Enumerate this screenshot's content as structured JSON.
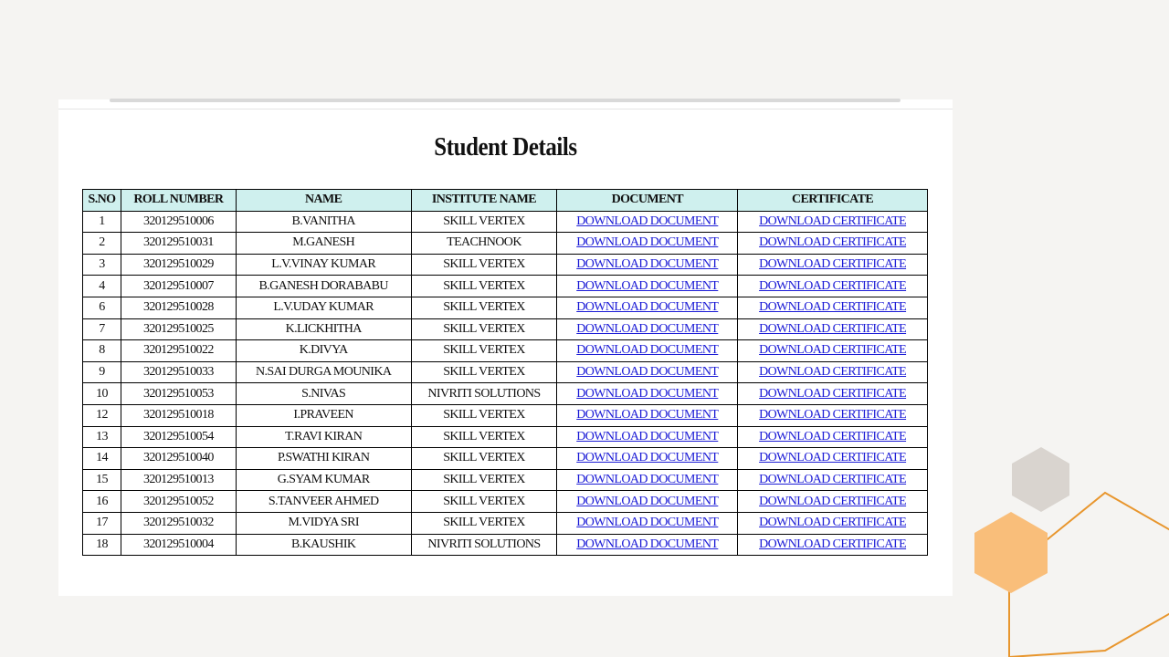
{
  "page": {
    "title": "Student Details"
  },
  "table": {
    "headers": [
      "S.NO",
      "ROLL NUMBER",
      "NAME",
      "INSTITUTE NAME",
      "DOCUMENT",
      "CERTIFICATE"
    ],
    "rows": [
      {
        "sno": "1",
        "roll": "320129510006",
        "name": "B.VANITHA",
        "institute": "SKILL VERTEX",
        "document": "DOWNLOAD DOCUMENT",
        "certificate": "DOWNLOAD CERTIFICATE"
      },
      {
        "sno": "2",
        "roll": "320129510031",
        "name": "M.GANESH",
        "institute": "TEACHNOOK",
        "document": "DOWNLOAD DOCUMENT",
        "certificate": "DOWNLOAD CERTIFICATE"
      },
      {
        "sno": "3",
        "roll": "320129510029",
        "name": "L.V.VINAY KUMAR",
        "institute": "SKILL VERTEX",
        "document": "DOWNLOAD DOCUMENT",
        "certificate": "DOWNLOAD CERTIFICATE"
      },
      {
        "sno": "4",
        "roll": "320129510007",
        "name": "B.GANESH DORABABU",
        "institute": "SKILL VERTEX",
        "document": "DOWNLOAD DOCUMENT",
        "certificate": "DOWNLOAD CERTIFICATE"
      },
      {
        "sno": "6",
        "roll": "320129510028",
        "name": "L.V.UDAY KUMAR",
        "institute": "SKILL VERTEX",
        "document": "DOWNLOAD DOCUMENT",
        "certificate": "DOWNLOAD CERTIFICATE"
      },
      {
        "sno": "7",
        "roll": "320129510025",
        "name": "K.LICKHITHA",
        "institute": "SKILL VERTEX",
        "document": "DOWNLOAD DOCUMENT",
        "certificate": "DOWNLOAD CERTIFICATE"
      },
      {
        "sno": "8",
        "roll": "320129510022",
        "name": "K.DIVYA",
        "institute": "SKILL VERTEX",
        "document": "DOWNLOAD DOCUMENT",
        "certificate": "DOWNLOAD CERTIFICATE"
      },
      {
        "sno": "9",
        "roll": "320129510033",
        "name": "N.SAI DURGA MOUNIKA",
        "institute": "SKILL VERTEX",
        "document": "DOWNLOAD DOCUMENT",
        "certificate": "DOWNLOAD CERTIFICATE"
      },
      {
        "sno": "10",
        "roll": "320129510053",
        "name": "S.NIVAS",
        "institute": "NIVRITI SOLUTIONS",
        "document": "DOWNLOAD DOCUMENT",
        "certificate": "DOWNLOAD CERTIFICATE"
      },
      {
        "sno": "12",
        "roll": "320129510018",
        "name": "I.PRAVEEN",
        "institute": "SKILL VERTEX",
        "document": "DOWNLOAD DOCUMENT",
        "certificate": "DOWNLOAD CERTIFICATE"
      },
      {
        "sno": "13",
        "roll": "320129510054",
        "name": "T.RAVI KIRAN",
        "institute": "SKILL VERTEX",
        "document": "DOWNLOAD DOCUMENT",
        "certificate": "DOWNLOAD CERTIFICATE"
      },
      {
        "sno": "14",
        "roll": "320129510040",
        "name": "P.SWATHI KIRAN",
        "institute": "SKILL VERTEX",
        "document": "DOWNLOAD DOCUMENT",
        "certificate": "DOWNLOAD CERTIFICATE"
      },
      {
        "sno": "15",
        "roll": "320129510013",
        "name": "G.SYAM KUMAR",
        "institute": "SKILL VERTEX",
        "document": "DOWNLOAD DOCUMENT",
        "certificate": "DOWNLOAD CERTIFICATE"
      },
      {
        "sno": "16",
        "roll": "320129510052",
        "name": "S.TANVEER AHMED",
        "institute": "SKILL VERTEX",
        "document": "DOWNLOAD DOCUMENT",
        "certificate": "DOWNLOAD CERTIFICATE"
      },
      {
        "sno": "17",
        "roll": "320129510032",
        "name": "M.VIDYA SRI",
        "institute": "SKILL VERTEX",
        "document": "DOWNLOAD DOCUMENT",
        "certificate": "DOWNLOAD CERTIFICATE"
      },
      {
        "sno": "18",
        "roll": "320129510004",
        "name": "B.KAUSHIK",
        "institute": "NIVRITI SOLUTIONS",
        "document": "DOWNLOAD DOCUMENT",
        "certificate": "DOWNLOAD CERTIFICATE"
      }
    ]
  },
  "colors": {
    "background": "#f5f4f2",
    "header_fill": "#cff0ee",
    "link": "#1b1bd6",
    "hex_gray": "#d9d4cf",
    "hex_orange": "#f9be7a",
    "hex_outline": "#e8962e"
  }
}
